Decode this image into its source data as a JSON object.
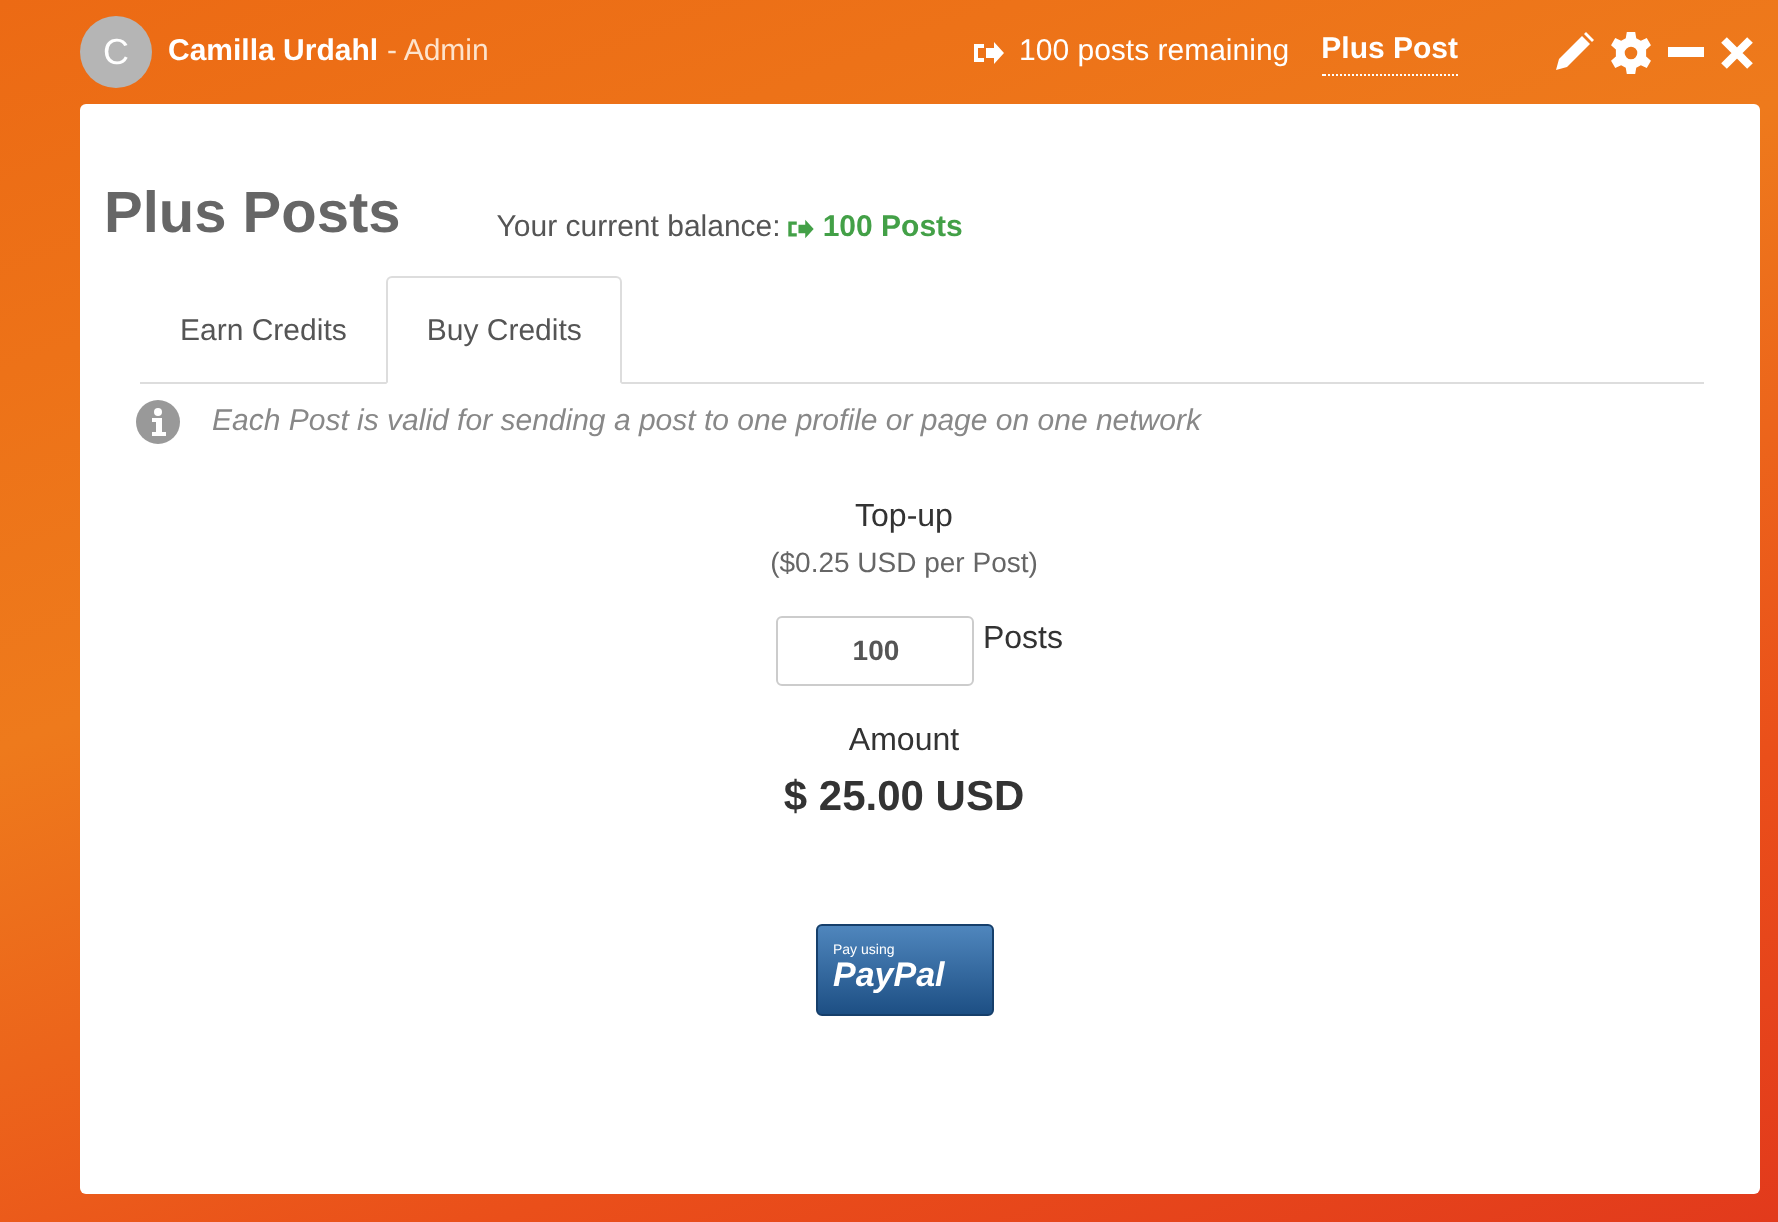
{
  "header": {
    "avatar_letter": "C",
    "user_name": "Camilla Urdahl",
    "role": "- Admin",
    "remaining": "100 posts remaining",
    "plan_link": "Plus Post"
  },
  "page": {
    "title": "Plus Posts",
    "balance_label": "Your current balance:",
    "balance_value": "100 Posts"
  },
  "tabs": [
    {
      "label": "Earn Credits",
      "selected": false
    },
    {
      "label": "Buy Credits",
      "selected": true
    }
  ],
  "info": "Each Post is valid for sending a post to one profile or page on one network",
  "topup": {
    "title": "Top-up",
    "rate": "($0.25 USD per Post)",
    "quantity": "100",
    "unit": "Posts",
    "amount_label": "Amount",
    "amount": "$ 25.00 USD"
  },
  "paypal_button": {
    "caption": "Pay using",
    "brand": "PayPal"
  }
}
